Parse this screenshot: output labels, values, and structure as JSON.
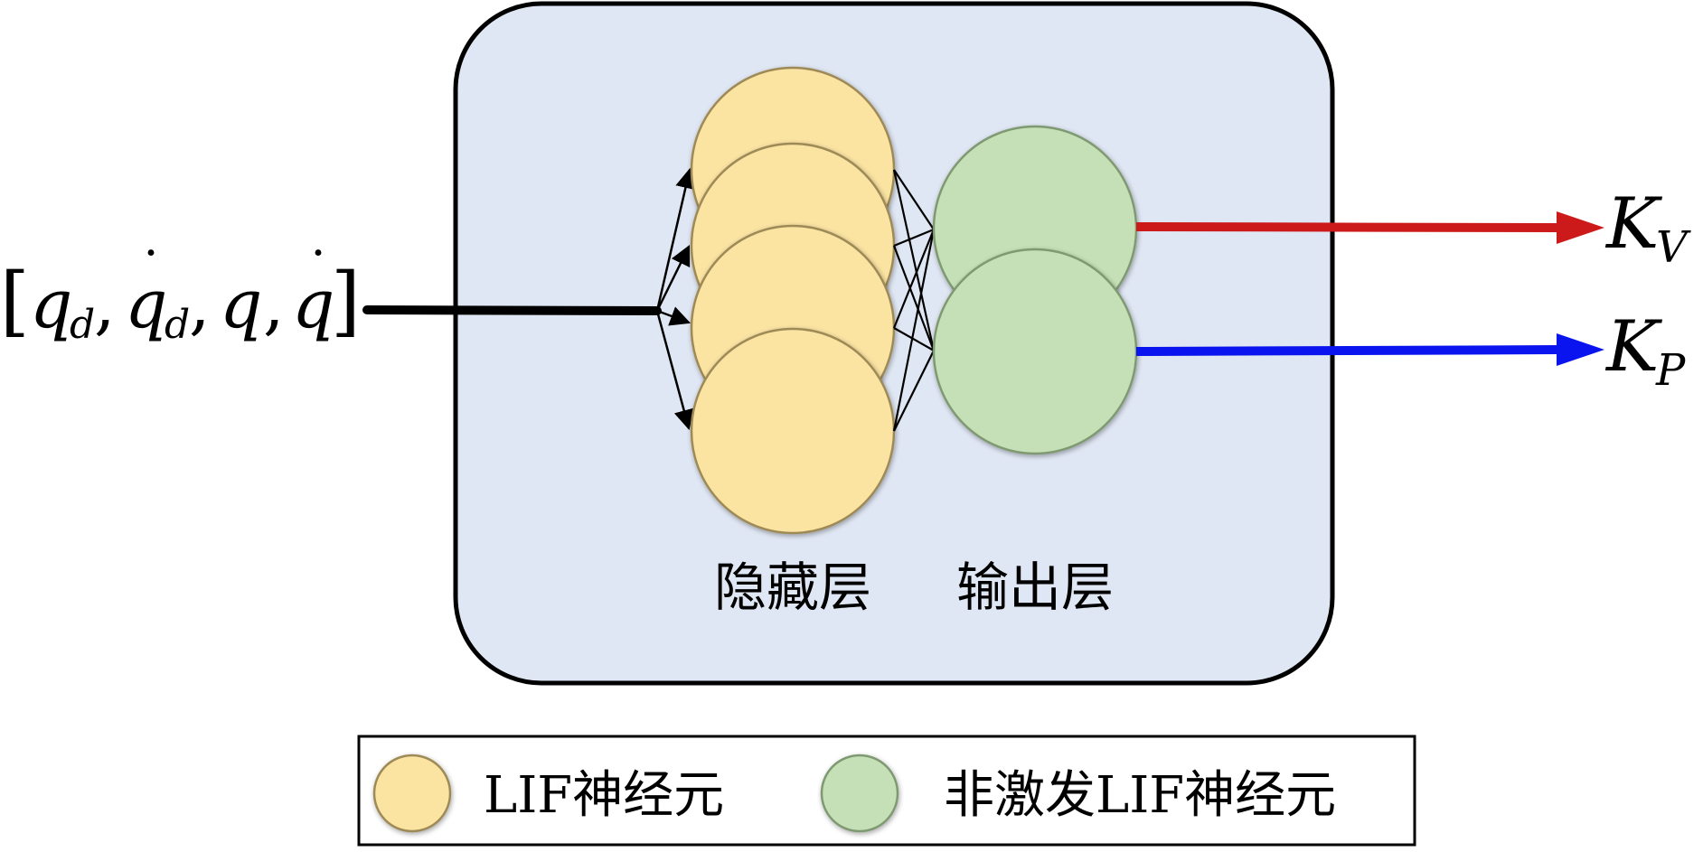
{
  "colors": {
    "panel_fill": "#e0e7f4",
    "panel_stroke": "#000000",
    "hidden_neuron_fill": "#fbe3a2",
    "hidden_neuron_stroke": "#9e8a56",
    "output_neuron_fill": "#c5e0b6",
    "output_neuron_stroke": "#7f9a72",
    "kv_arrow": "#cc1a1a",
    "kp_arrow": "#0a14ee",
    "input_line": "#000000"
  },
  "input": {
    "open_bracket": "[",
    "q_d": "q",
    "q_d_sub": "d",
    "sep1": ",",
    "qdot_d": "q",
    "qdot_d_sub": "d",
    "sep2": ",",
    "q": "q",
    "sep3": ",",
    "qdot": "q",
    "dot": "˙",
    "close_bracket": "]"
  },
  "outputs": {
    "kv_main": "K",
    "kv_sub": "V",
    "kp_main": "K",
    "kp_sub": "P"
  },
  "layers": {
    "hidden_label": "隐藏层",
    "output_label": "输出层",
    "hidden_neuron_count": 4,
    "output_neuron_count": 2
  },
  "legend": {
    "lif_label": "LIF神经元",
    "non_spiking_label": "非激发LIF神经元"
  }
}
